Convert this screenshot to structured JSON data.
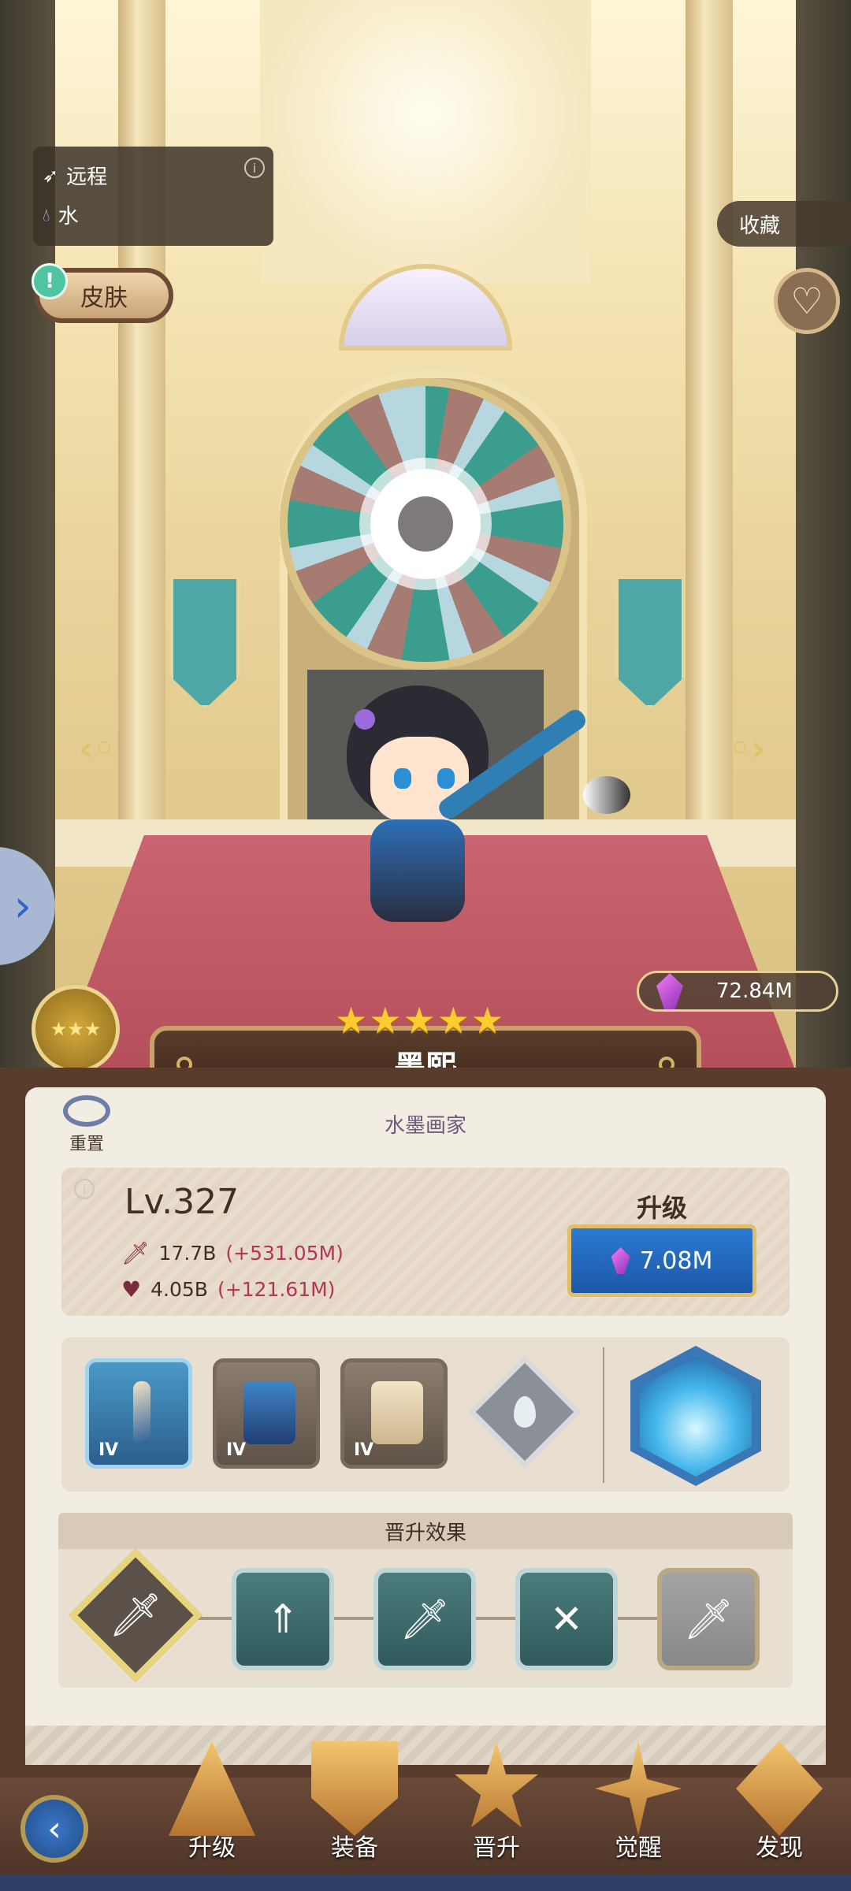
{
  "hero": {
    "name": "墨熙",
    "title": "水墨画家",
    "stars": 5,
    "attack_type": "远程",
    "element": "水"
  },
  "buttons": {
    "skin": "皮肤",
    "favorite": "收藏",
    "reset": "重置",
    "upgrade_title": "升级",
    "upgrade_cost": "7.08M"
  },
  "currency": {
    "amount": "72.84M"
  },
  "stats": {
    "level": "Lv.327",
    "attack": "17.7B",
    "attack_bonus": "(+531.05M)",
    "hp": "4.05B",
    "hp_bonus": "(+121.61M)"
  },
  "equipment": [
    {
      "name": "weapon",
      "tier": "IV"
    },
    {
      "name": "armor",
      "tier": "IV"
    },
    {
      "name": "scroll",
      "tier": "IV"
    }
  ],
  "promotion": {
    "title": "晋升效果"
  },
  "nav": [
    {
      "label": "升级"
    },
    {
      "label": "装备"
    },
    {
      "label": "晋升"
    },
    {
      "label": "觉醒"
    },
    {
      "label": "发现"
    }
  ],
  "colors": {
    "accent_gold": "#e1bd68",
    "upgrade_blue": "#2a7bd2",
    "bonus_red": "#b2355a",
    "panel_bg": "#f2ede3"
  }
}
